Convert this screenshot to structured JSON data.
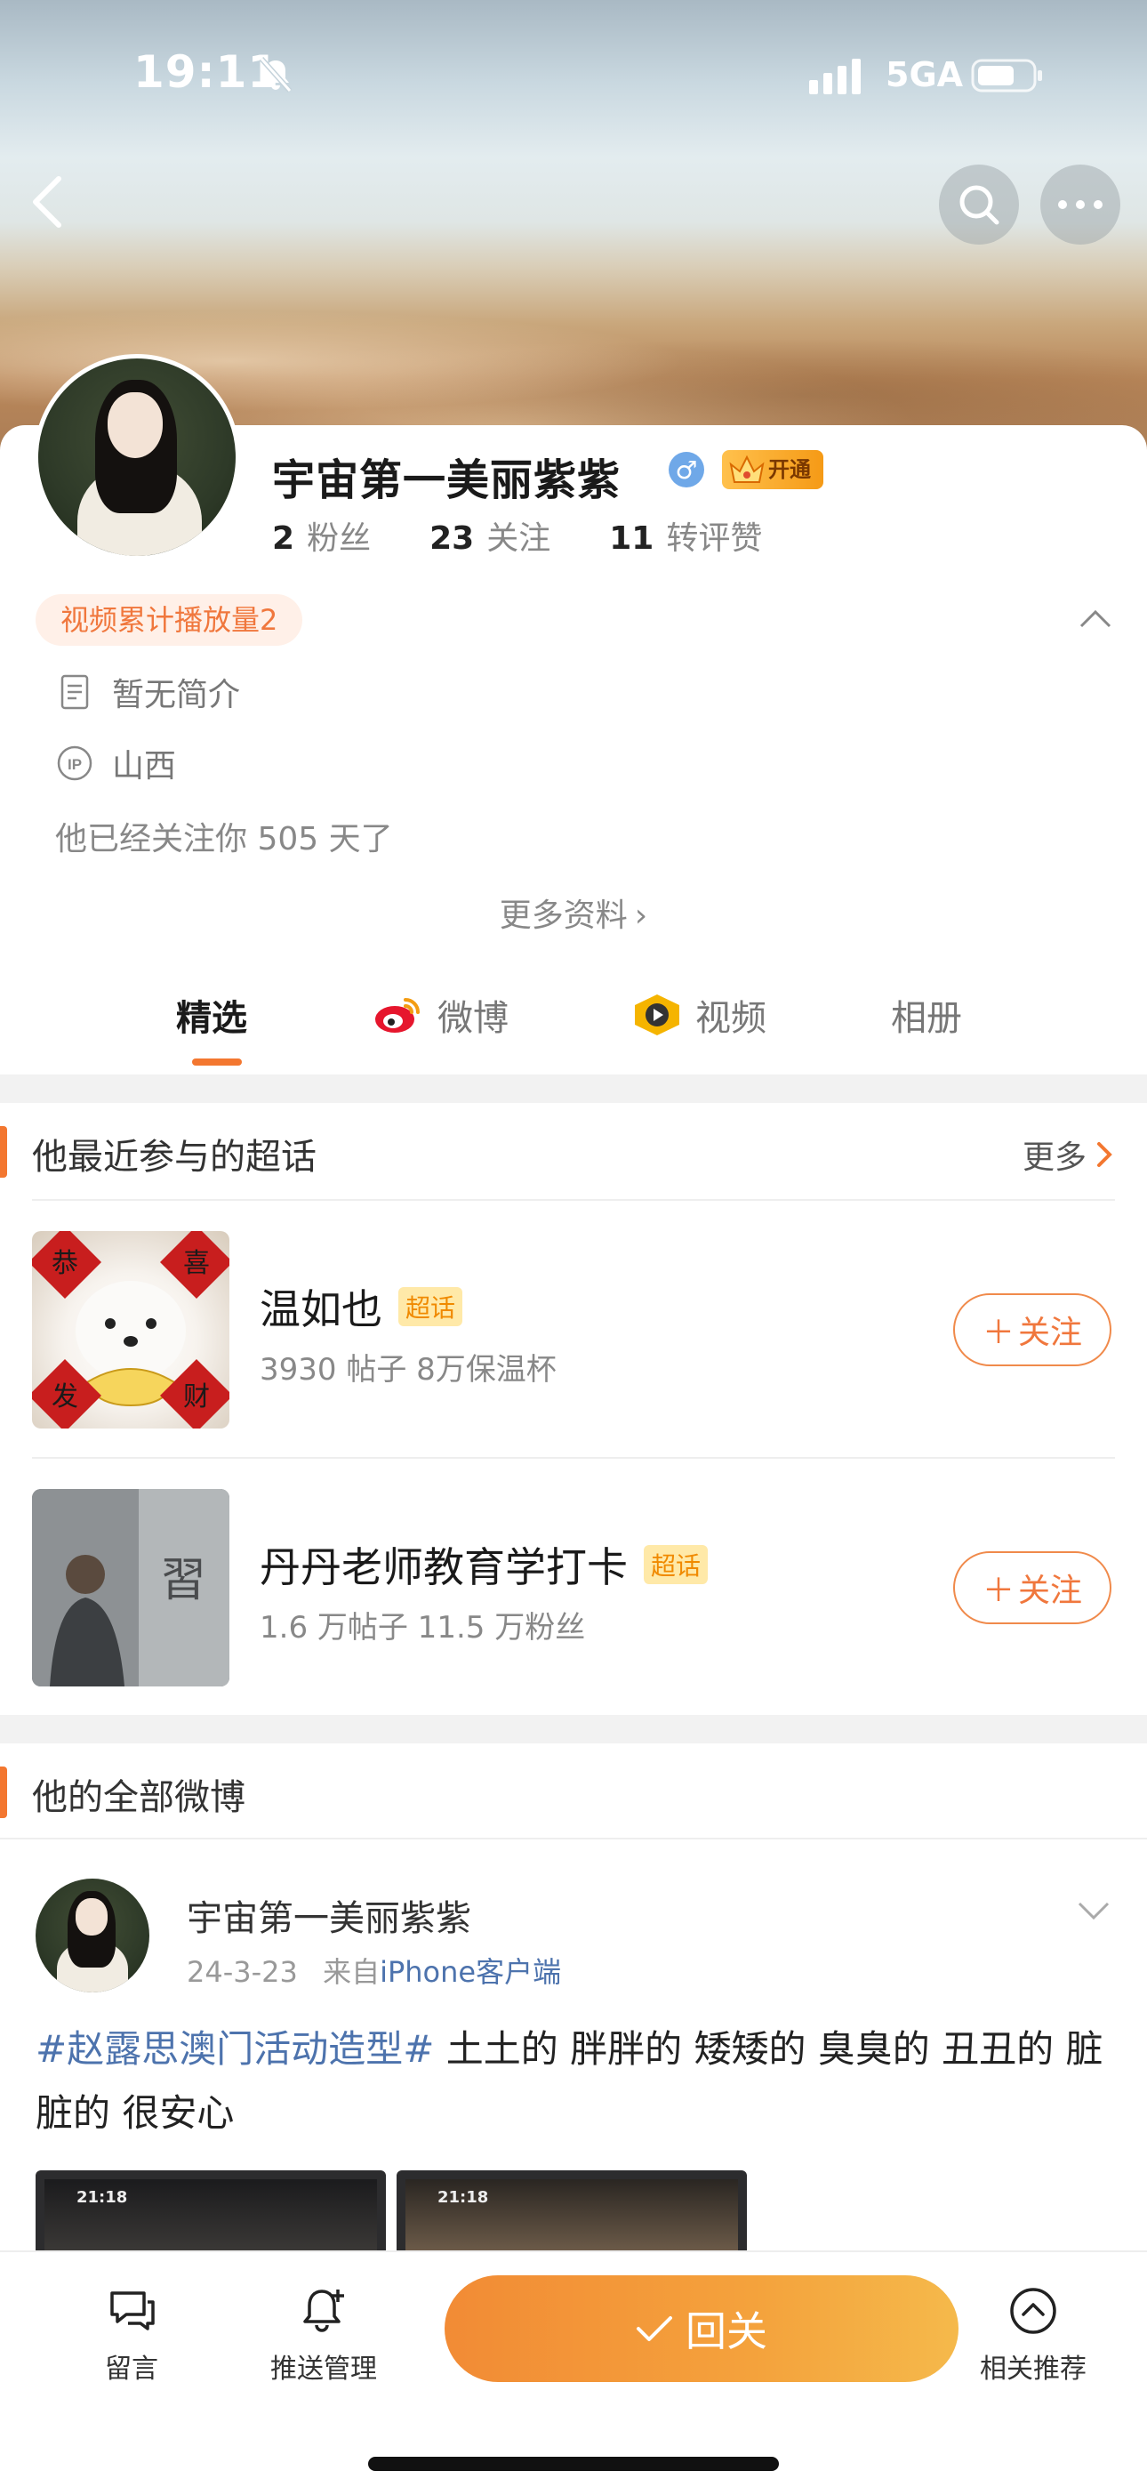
{
  "status_bar": {
    "time": "19:11",
    "network": "5GA"
  },
  "profile": {
    "name": "宇宙第一美丽紫紫",
    "gender_symbol": "♂",
    "vip_label": "开通",
    "stats": [
      {
        "value": "2",
        "label": "粉丝"
      },
      {
        "value": "23",
        "label": "关注"
      },
      {
        "value": "11",
        "label": "转评赞"
      }
    ],
    "play_tag": "视频累计播放量2",
    "intro": "暂无简介",
    "ip_location": "山西",
    "follow_days": "他已经关注你 505 天了",
    "more_info": "更多资料"
  },
  "tabs": [
    {
      "label": "精选",
      "icon": ""
    },
    {
      "label": "微博",
      "icon": "weibo-icon"
    },
    {
      "label": "视频",
      "icon": "video-icon"
    },
    {
      "label": "相册",
      "icon": ""
    }
  ],
  "supertopics": {
    "title": "他最近参与的超话",
    "more": "更多",
    "items": [
      {
        "name": "温如也",
        "tag": "超话",
        "meta": "3930 帖子 8万保温杯",
        "follow": "关注",
        "thumb_text": [
          "恭",
          "喜",
          "发",
          "财"
        ]
      },
      {
        "name": "丹丹老师教育学打卡",
        "tag": "超话",
        "meta": "1.6 万帖子 11.5 万粉丝",
        "follow": "关注",
        "thumb_text": [
          "習"
        ]
      }
    ]
  },
  "weibo": {
    "title": "他的全部微博",
    "post": {
      "user": "宇宙第一美丽紫紫",
      "date": "24-3-23",
      "from_label": "来自",
      "source": "iPhone客户端",
      "hashtag": "#赵露思澳门活动造型#",
      "text": " 土土的 胖胖的 矮矮的 臭臭的 丑丑的 脏脏的 很安心",
      "shots": [
        "21:18",
        "21:18"
      ]
    }
  },
  "bottom_bar": {
    "message": "留言",
    "push": "推送管理",
    "follow_back": "回关",
    "related": "相关推荐"
  },
  "colors": {
    "accent": "#f37730",
    "link": "#4d73ad"
  }
}
